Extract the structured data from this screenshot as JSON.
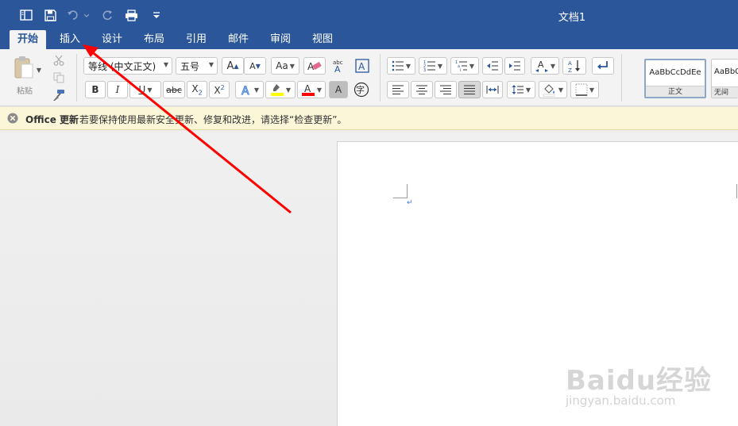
{
  "window": {
    "title": "文档1"
  },
  "tabs": [
    "开始",
    "插入",
    "设计",
    "布局",
    "引用",
    "邮件",
    "审阅",
    "视图"
  ],
  "clipboard": {
    "paste_label": "粘贴"
  },
  "font": {
    "name": "等线 (中文正文)",
    "size": "五号",
    "char_icon": "字"
  },
  "styles": [
    {
      "sample": "AaBbCcDdEe",
      "name": "正文"
    },
    {
      "sample": "AaBbCcDdE",
      "name": "无间"
    }
  ],
  "message_bar": {
    "title": "Office 更新",
    "text": "若要保持使用最新安全更新、修复和改进，请选择“检查更新”。"
  },
  "watermark": {
    "main": "Baidu经验",
    "sub": "jingyan.baidu.com"
  },
  "colors": {
    "brand": "#2b579a",
    "annotation": "#ff0000",
    "highlight": "#ffff00",
    "font_color": "#ff0000"
  }
}
